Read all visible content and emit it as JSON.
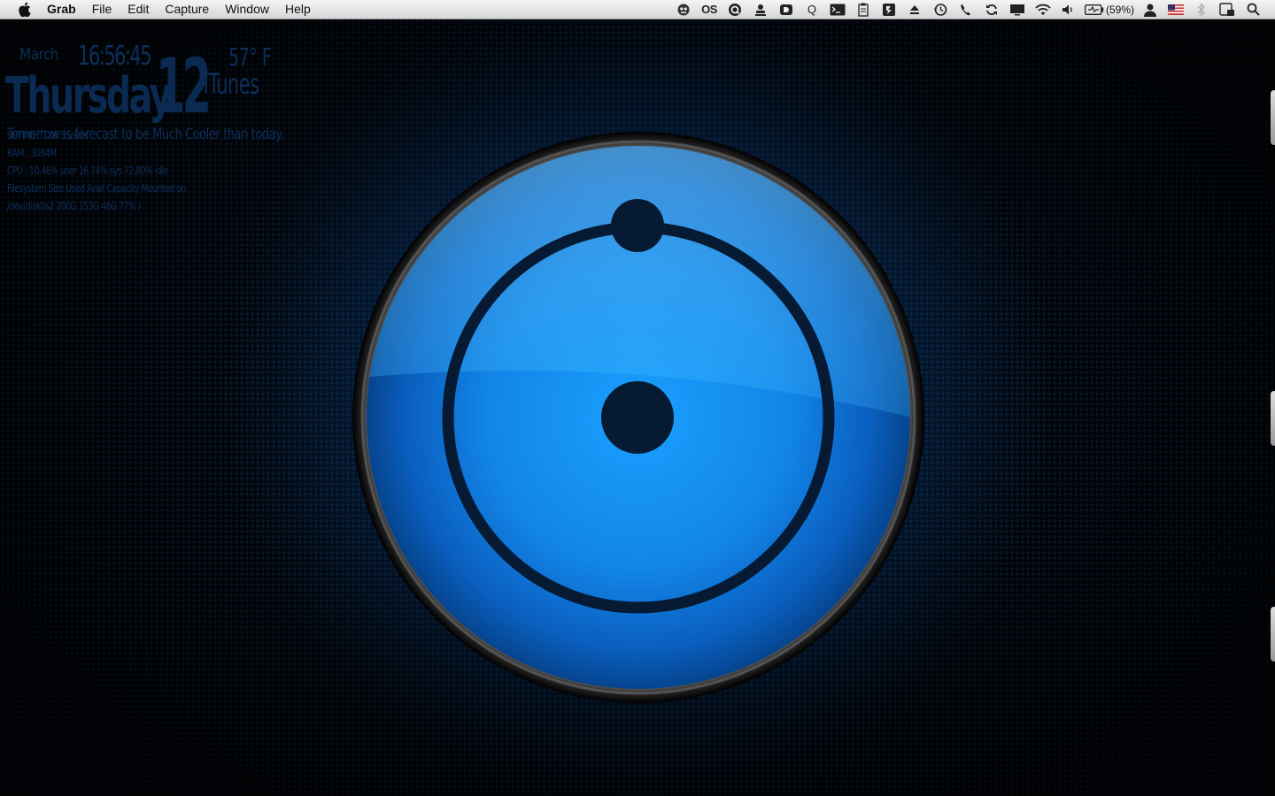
{
  "menubar": {
    "app_name": "Grab",
    "menus": [
      "File",
      "Edit",
      "Capture",
      "Window",
      "Help"
    ],
    "status": {
      "os_label": "OS",
      "q_label": "Q",
      "battery_text": "(59%)"
    }
  },
  "geektool": {
    "month": "March",
    "time": "16:56:45",
    "day": "Thursday",
    "date": "12",
    "temperature": "57° F",
    "itunes": "iTunes",
    "forecast": "Tomorrow is forecast to be Much Cooler than today.",
    "uptime": "UPTIME : 7:06  5 users",
    "ram": "RAM : 3084M",
    "cpu": "CPU : 10.46% user  16.74% sys  72.80% idle",
    "fs_header": "Filesystem      Size    Used   Avail  Capacity   Mounted on",
    "fs_row": "/dev/disk0s2    200G    153G    46G     77%      /"
  },
  "colors": {
    "orb_blue": "#1a8fe8",
    "orb_dark": "#061a33",
    "text_blue": "#0d2f5a"
  }
}
